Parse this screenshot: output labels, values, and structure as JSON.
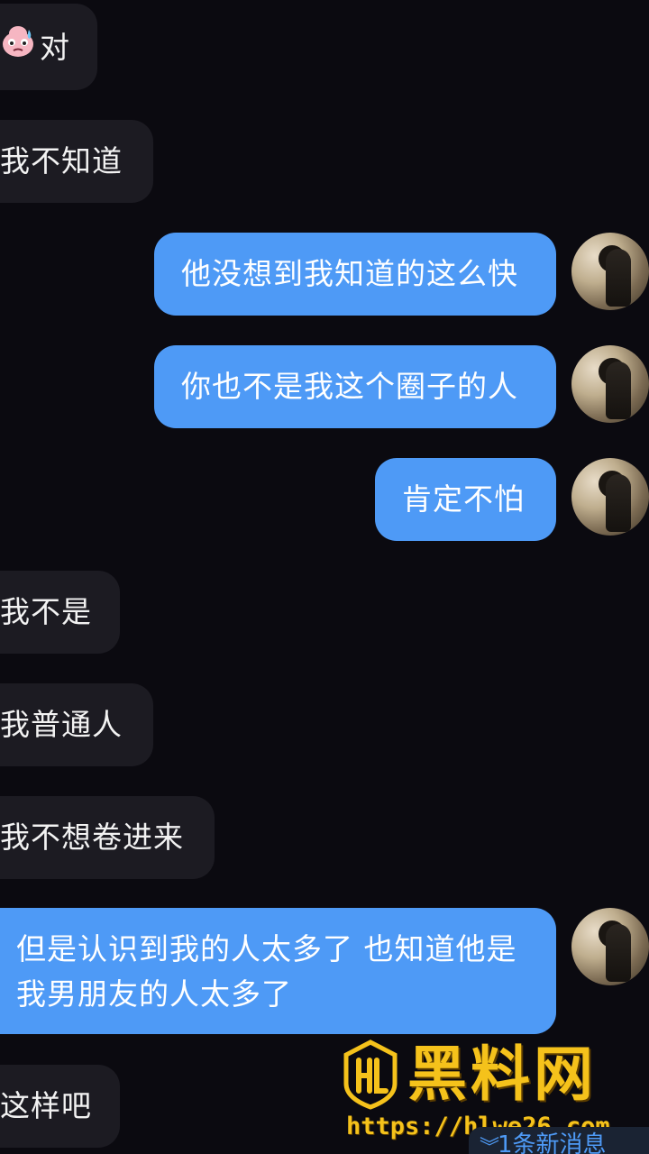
{
  "messages": [
    {
      "side": "in",
      "text": "对",
      "emoji": "sweat-face"
    },
    {
      "side": "in",
      "text": "我不知道"
    },
    {
      "side": "out",
      "text": "他没想到我知道的这么快"
    },
    {
      "side": "out",
      "text": "你也不是我这个圈子的人"
    },
    {
      "side": "out",
      "text": "肯定不怕"
    },
    {
      "side": "in",
      "text": "我不是"
    },
    {
      "side": "in",
      "text": "我普通人"
    },
    {
      "side": "in",
      "text": "我不想卷进来"
    },
    {
      "side": "out",
      "lines": [
        "但是认识到我的人太多了 也知道他是",
        "我男朋友的人太多了"
      ]
    },
    {
      "side": "in",
      "text": "这样吧"
    }
  ],
  "watermark": {
    "title": "黑料网",
    "url": "https://hlwe26.com",
    "logo_icon": "hl-shield-logo"
  },
  "new_message_bar": {
    "text": "1条新消息",
    "icon": "double-chevron-down-icon"
  },
  "colors": {
    "background": "#0b0a10",
    "incoming_bubble": "#1c1b22",
    "outgoing_bubble": "#4e9af6",
    "watermark": "#f5c21b"
  }
}
